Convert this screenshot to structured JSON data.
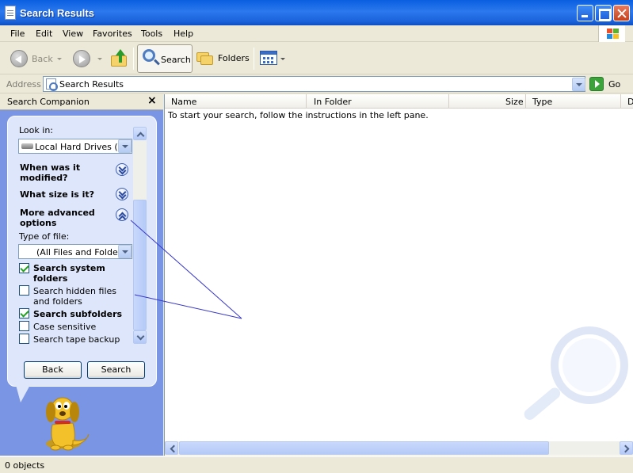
{
  "window": {
    "title": "Search Results"
  },
  "menu": {
    "items": [
      "File",
      "Edit",
      "View",
      "Favorites",
      "Tools",
      "Help"
    ]
  },
  "toolbar": {
    "back_label": "Back",
    "search_label": "Search",
    "folders_label": "Folders"
  },
  "address": {
    "label": "Address",
    "value": "Search Results",
    "go_label": "Go"
  },
  "side_pane": {
    "title": "Search Companion",
    "close": "×",
    "look_in_label": "Look in:",
    "look_in_value": "Local Hard Drives (C:)",
    "when_modified": "When was it modified?",
    "what_size": "What size is it?",
    "more_advanced": "More advanced options",
    "type_of_file_label": "Type of file:",
    "type_of_file_value": "(All Files and Folders)",
    "options": [
      {
        "label": "Search system folders",
        "checked": true,
        "bold": true
      },
      {
        "label": "Search hidden files and folders",
        "checked": false,
        "bold": false
      },
      {
        "label": "Search subfolders",
        "checked": true,
        "bold": true
      },
      {
        "label": "Case sensitive",
        "checked": false,
        "bold": false
      },
      {
        "label": "Search tape backup",
        "checked": false,
        "bold": false
      }
    ],
    "back_button": "Back",
    "search_button": "Search"
  },
  "results": {
    "columns": [
      "Name",
      "In Folder",
      "Size",
      "Type",
      "D"
    ],
    "hint": "To start your search, follow the instructions in the left pane."
  },
  "status": {
    "text": "0 objects"
  }
}
